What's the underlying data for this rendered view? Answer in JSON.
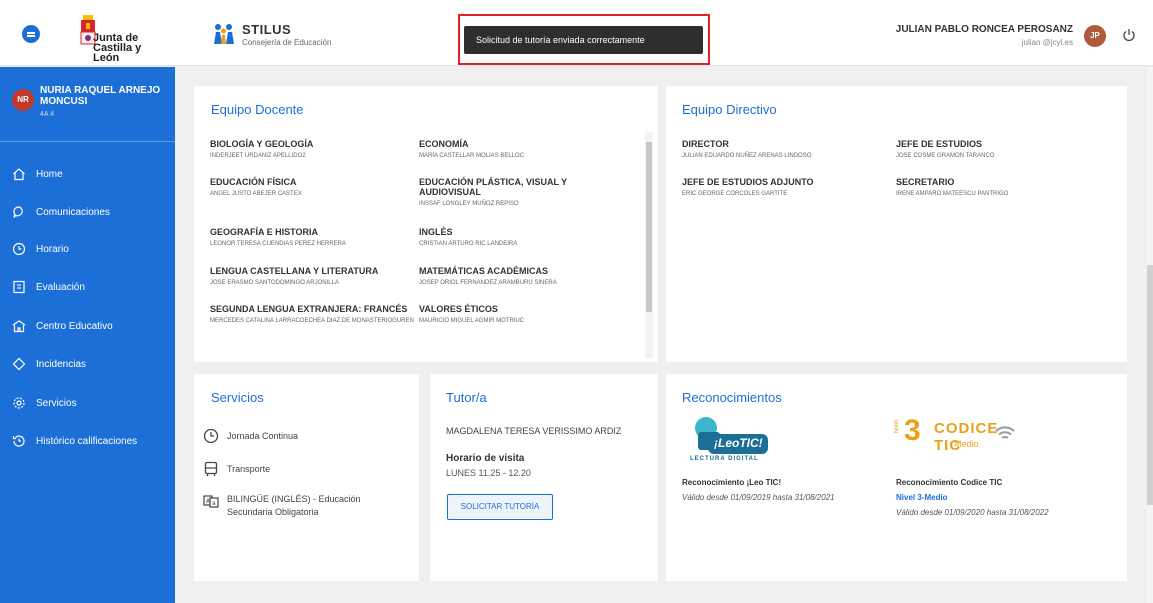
{
  "header": {
    "org_line1": "Junta de",
    "org_line2": "Castilla y León",
    "app_name": "STILUS",
    "app_subtitle": "Consejería de Educación",
    "toast": "Solicitud de tutoría enviada correctamente",
    "user_name": "JULIAN PABLO RONCEA PEROSANZ",
    "user_email": "julian @jcyl.es",
    "user_initials": "JP"
  },
  "sidebar": {
    "student_initials": "NR",
    "student_name": "NURIA RAQUEL ARNEJO MONCUSI",
    "student_group": "4A 4",
    "items": [
      {
        "label": "Home",
        "icon": "home-icon"
      },
      {
        "label": "Comunicaciones",
        "icon": "chat-icon"
      },
      {
        "label": "Horario",
        "icon": "clock-icon"
      },
      {
        "label": "Evaluación",
        "icon": "grade-icon"
      },
      {
        "label": "Centro Educativo",
        "icon": "school-icon"
      },
      {
        "label": "Incidencias",
        "icon": "diamond-icon"
      },
      {
        "label": "Servicios",
        "icon": "gear-icon"
      },
      {
        "label": "Histórico calificaciones",
        "icon": "history-icon"
      }
    ]
  },
  "docente": {
    "title": "Equipo Docente",
    "subjects": [
      {
        "name": "BIOLOGÍA Y GEOLOGÍA",
        "teacher": "INDERJEET URDANIZ APELLIDO2"
      },
      {
        "name": "ECONOMÍA",
        "teacher": "MARIA CASTELLAR MOLIAS BELLOC"
      },
      {
        "name": "EDUCACIÓN FÍSICA",
        "teacher": "ANGEL JUSTO ABEJER CASTEX"
      },
      {
        "name": "EDUCACIÓN PLÁSTICA, VISUAL Y AUDIOVISUAL",
        "teacher": "INSSAF LONGLEY MUÑOZ REPISO"
      },
      {
        "name": "GEOGRAFÍA E HISTORIA",
        "teacher": "LEONOR TERESA CUENDIAS PEREZ HERRERA"
      },
      {
        "name": "INGLÉS",
        "teacher": "CRISTIAN ARTURO RIC LANDEIRA"
      },
      {
        "name": "LENGUA CASTELLANA Y LITERATURA",
        "teacher": "JOSE ERASMO SANTODOMINGO ARJONILLA"
      },
      {
        "name": "MATEMÁTICAS ACADÉMICAS",
        "teacher": "JOSEP ORIOL FERNANDEZ ARAMBURU SINERA"
      },
      {
        "name": "SEGUNDA LENGUA EXTRANJERA: FRANCÉS",
        "teacher": "MERCEDES CATALINA LARRACOECHEA DIAZ DE MONASTERIOGUREN"
      },
      {
        "name": "VALORES ÉTICOS",
        "teacher": "MAURICIO MIGUEL AGMIR MOTRIUC"
      }
    ]
  },
  "directivo": {
    "title": "Equipo Directivo",
    "roles": [
      {
        "role": "DIRECTOR",
        "person": "JULIAN EDUARDO NUÑEZ ARENAS LINDOSO"
      },
      {
        "role": "JEFE DE ESTUDIOS",
        "person": "JOSE COSME GRAMON TARANCO"
      },
      {
        "role": "JEFE DE ESTUDIOS ADJUNTO",
        "person": "ERIC GEORGE CORCOLES GARTITE"
      },
      {
        "role": "SECRETARIO",
        "person": "IRENE AMPARO MATEESCU PANTRIGO"
      }
    ]
  },
  "servicios": {
    "title": "Servicios",
    "items": [
      {
        "label": "Jornada Continua",
        "icon": "clock-icon"
      },
      {
        "label": "Transporte",
        "icon": "bus-icon"
      },
      {
        "label": "BILINGÜE (INGLÉS) - Educación Secundaria Obligatoria",
        "icon": "translate-icon"
      }
    ]
  },
  "tutor": {
    "title": "Tutor/a",
    "name": "MAGDALENA TERESA VERISSIMO ARDIZ",
    "visit_label": "Horario de visita",
    "visit_time": "LUNES 11.25 - 12.20",
    "button": "SOLICITAR TUTORÍA"
  },
  "reconocimientos": {
    "title": "Reconocimientos",
    "items": [
      {
        "logo_text": "¡LeoTIC!",
        "logo_sub": "LECTURA DIGITAL",
        "title": "Reconocimiento ¡Leo TIC!",
        "level": "",
        "validity": "Válido desde 01/09/2019 hasta 31/08/2021"
      },
      {
        "logo_text": "CODICE TIC",
        "logo_sub": "Medio",
        "logo_level_word": "Nivel",
        "logo_level_num": "3",
        "title": "Reconocimiento Codice TIC",
        "level": "Nivel 3-Medio",
        "validity": "Válido desde 01/09/2020 hasta 31/08/2022"
      }
    ]
  },
  "colors": {
    "primary": "#1d6fd8",
    "toast_bg": "#2e2e2e",
    "highlight": "#e0202a",
    "user_avatar": "#b05a3c",
    "student_avatar": "#c0392b"
  }
}
